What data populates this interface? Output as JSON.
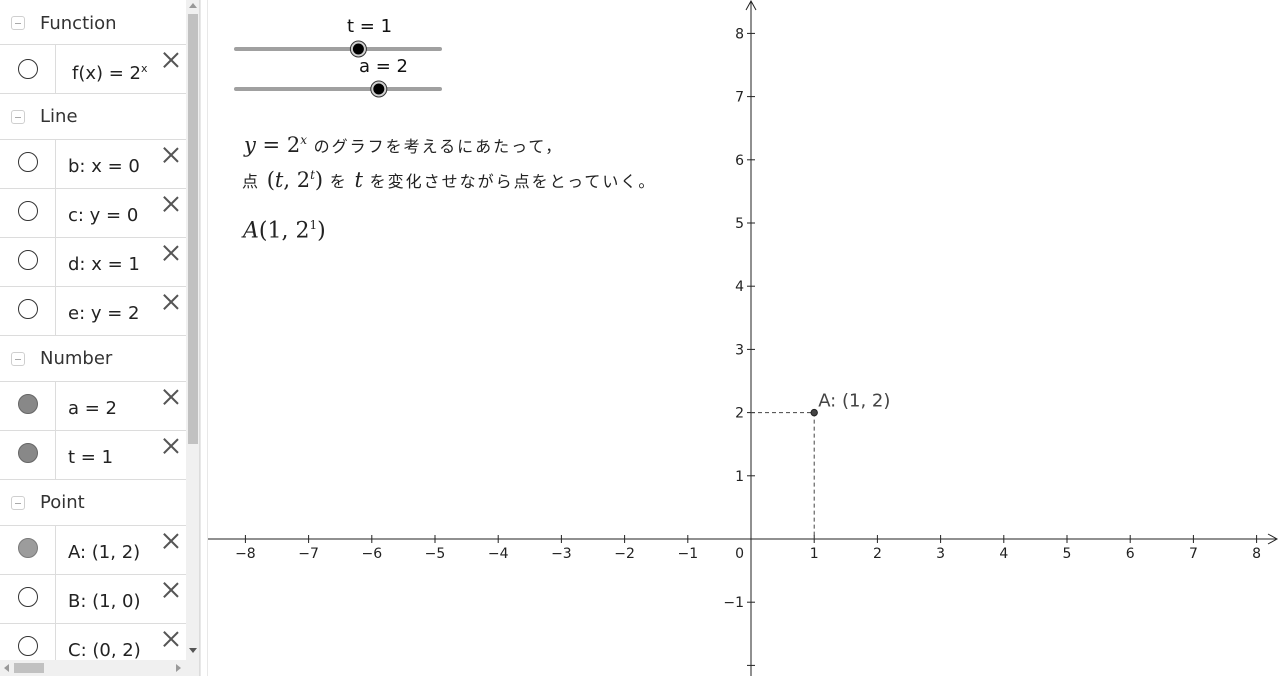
{
  "algebra": {
    "groups": [
      {
        "title": "Function",
        "items": [
          {
            "label": "f(x) = 2",
            "sup": "x",
            "visible": false
          }
        ]
      },
      {
        "title": "Line",
        "items": [
          {
            "label": "b: x = 0",
            "visible": false
          },
          {
            "label": "c: y = 0",
            "visible": false
          },
          {
            "label": "d: x = 1",
            "visible": false
          },
          {
            "label": "e: y = 2",
            "visible": false
          }
        ]
      },
      {
        "title": "Number",
        "items": [
          {
            "label": "a = 2",
            "visible": true
          },
          {
            "label": "t = 1",
            "visible": true
          }
        ]
      },
      {
        "title": "Point",
        "items": [
          {
            "label": "A: (1, 2)",
            "visible": true
          },
          {
            "label": "B: (1, 0)",
            "visible": false
          },
          {
            "label": "C: (0, 2)",
            "visible": false
          }
        ]
      }
    ]
  },
  "graphics": {
    "sliders": [
      {
        "label": "t = 1",
        "value": 1,
        "min": -5,
        "max": 5
      },
      {
        "label": "a = 2",
        "value": 2,
        "min": -5,
        "max": 5
      }
    ],
    "text": {
      "line1_y": "y",
      "line1_eq": " = 2",
      "line1_exp": "x",
      "line1_jp": "のグラフを考えるにあたって，",
      "line2_jp_a": "点",
      "line2_math_open": "(",
      "line2_math_t": "t",
      "line2_math_mid": ", 2",
      "line2_math_exp": "t",
      "line2_math_close": ")",
      "line2_jp_b": "を",
      "line2_t": "t",
      "line2_jp_c": "を変化させながら点をとっていく。",
      "point_expr_A": "A",
      "point_expr_body": "(1, 2",
      "point_expr_exp": "1",
      "point_expr_close": ")"
    },
    "point_label": "A: (1, 2)",
    "axes": {
      "xmin": -8.6,
      "xmax": 8.3,
      "ymin": -2.1,
      "ymax": 8.5,
      "x_ticks": [
        -8,
        -7,
        -6,
        -5,
        -4,
        -3,
        -2,
        -1,
        1,
        2,
        3,
        4,
        5,
        6,
        7,
        8
      ],
      "y_ticks": [
        -1,
        1,
        2,
        3,
        4,
        5,
        6,
        7,
        8
      ],
      "origin_label": "0"
    },
    "point": {
      "x": 1,
      "y": 2
    },
    "colors": {
      "axis": "#222222",
      "point": "#444444",
      "dashed": "#444444",
      "slider_track": "#a0a0a0"
    }
  }
}
